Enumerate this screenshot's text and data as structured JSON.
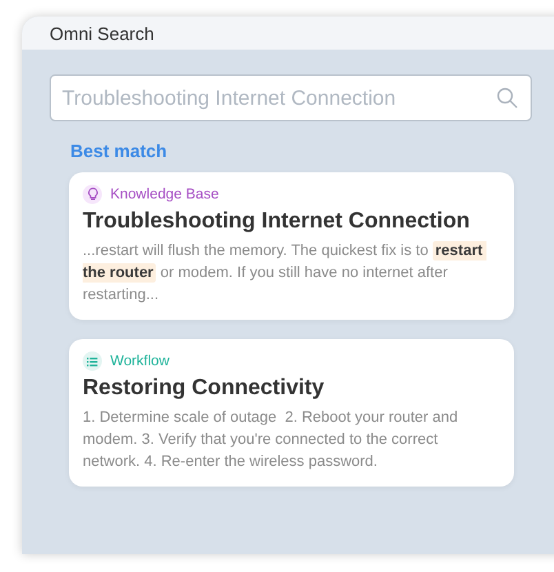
{
  "window": {
    "title": "Omni Search"
  },
  "search": {
    "placeholder": "Troubleshooting Internet Connection"
  },
  "section_label": "Best match",
  "results": [
    {
      "kind": "knowledge_base",
      "category": "Knowledge Base",
      "color": "#a64fc4",
      "title": "Troubleshooting Internet Connection",
      "snippet": "...restart will flush the memory. The quickest fix is to **restart the router** or modem. If you still have no internet after restarting..."
    },
    {
      "kind": "workflow",
      "category": "Workflow",
      "color": "#1fb39a",
      "title": "Restoring Connectivity",
      "snippet": "1. Determine scale of outage  2. Reboot your router and modem. 3. Verify that you're connected to the correct network. 4. Re-enter the wireless password."
    }
  ]
}
